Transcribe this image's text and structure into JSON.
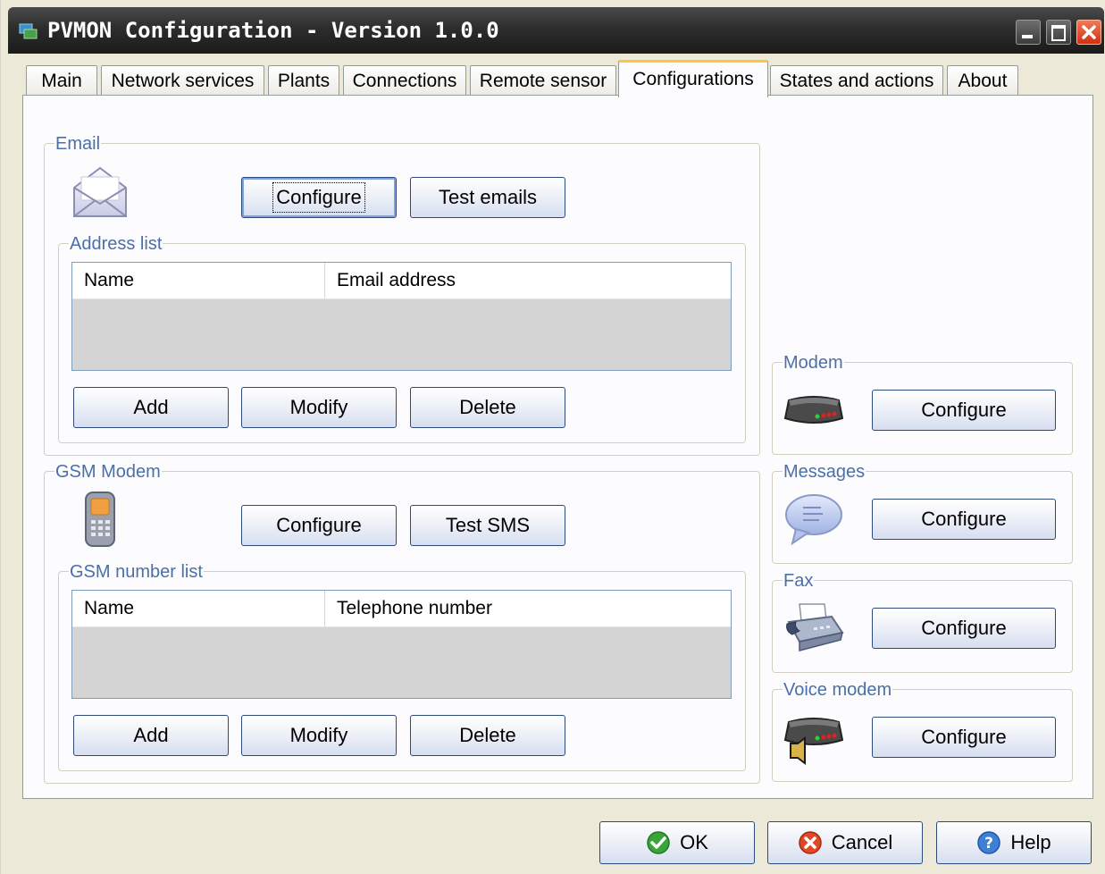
{
  "window": {
    "title": "PVMON Configuration - Version 1.0.0"
  },
  "tabs": [
    {
      "label": "Main"
    },
    {
      "label": "Network services"
    },
    {
      "label": "Plants"
    },
    {
      "label": "Connections"
    },
    {
      "label": "Remote sensor"
    },
    {
      "label": "Configurations",
      "active": true
    },
    {
      "label": "States and actions"
    },
    {
      "label": "About"
    }
  ],
  "email": {
    "legend": "Email",
    "configure_label": "Configure",
    "test_label": "Test emails",
    "address_list": {
      "legend": "Address list",
      "columns": [
        "Name",
        "Email address"
      ],
      "rows": []
    },
    "add_label": "Add",
    "modify_label": "Modify",
    "delete_label": "Delete"
  },
  "gsm": {
    "legend": "GSM Modem",
    "configure_label": "Configure",
    "test_label": "Test SMS",
    "number_list": {
      "legend": "GSM number list",
      "columns": [
        "Name",
        "Telephone number"
      ],
      "rows": []
    },
    "add_label": "Add",
    "modify_label": "Modify",
    "delete_label": "Delete"
  },
  "modem": {
    "legend": "Modem",
    "configure_label": "Configure"
  },
  "messages": {
    "legend": "Messages",
    "configure_label": "Configure"
  },
  "fax": {
    "legend": "Fax",
    "configure_label": "Configure"
  },
  "voice_modem": {
    "legend": "Voice modem",
    "configure_label": "Configure"
  },
  "footer": {
    "ok_label": "OK",
    "cancel_label": "Cancel",
    "help_label": "Help"
  },
  "colors": {
    "legend_text": "#4b6fa8",
    "titlebar": "#2d2d2d",
    "active_tab_accent": "#ffc83c",
    "close_button": "#d03010"
  }
}
